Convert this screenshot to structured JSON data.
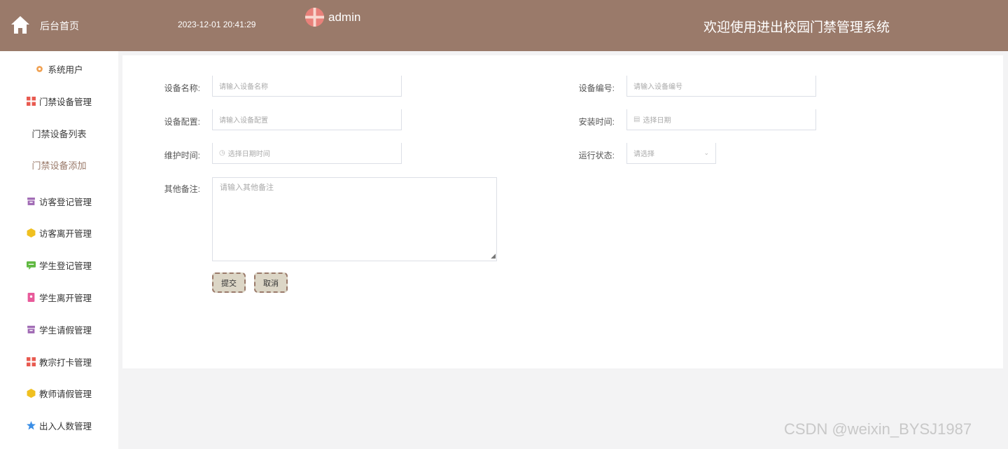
{
  "header": {
    "home_label": "后台首页",
    "datetime": "2023-12-01 20:41:29",
    "username": "admin",
    "system_title": "欢迎使用进出校园门禁管理系统"
  },
  "sidebar": {
    "items": [
      {
        "label": "系统用户",
        "icon": "gear-icon",
        "color": "#f0a050"
      },
      {
        "label": "门禁设备管理",
        "icon": "grid-icon",
        "color": "#e85a50"
      },
      {
        "label": "门禁设备列表"
      },
      {
        "label": "门禁设备添加"
      },
      {
        "label": "访客登记管理",
        "icon": "box-icon",
        "color": "#a06ab4"
      },
      {
        "label": "访客离开管理",
        "icon": "cube-icon",
        "color": "#f0c020"
      },
      {
        "label": "学生登记管理",
        "icon": "message-icon",
        "color": "#5fb840"
      },
      {
        "label": "学生离开管理",
        "icon": "document-icon",
        "color": "#e85a9a"
      },
      {
        "label": "学生请假管理",
        "icon": "box-icon",
        "color": "#a06ab4"
      },
      {
        "label": "教宗打卡管理",
        "icon": "grid-icon",
        "color": "#e85a50"
      },
      {
        "label": "教师请假管理",
        "icon": "cube-icon",
        "color": "#f0c020"
      },
      {
        "label": "出入人数管理",
        "icon": "star-icon",
        "color": "#3a8ee6"
      }
    ]
  },
  "form": {
    "device_name": {
      "label": "设备名称:",
      "placeholder": "请输入设备名称"
    },
    "device_no": {
      "label": "设备编号:",
      "placeholder": "请输入设备编号"
    },
    "device_config": {
      "label": "设备配置:",
      "placeholder": "请输入设备配置"
    },
    "install_time": {
      "label": "安装时间:",
      "placeholder": "选择日期"
    },
    "maintain_time": {
      "label": "维护时间:",
      "placeholder": "选择日期时间"
    },
    "run_status": {
      "label": "运行状态:",
      "placeholder": "请选择"
    },
    "remarks": {
      "label": "其他备注:",
      "placeholder": "请输入其他备注"
    },
    "submit_label": "提交",
    "cancel_label": "取消"
  },
  "watermark": "CSDN @weixin_BYSJ1987",
  "colors": {
    "header_bg": "#9a7a6a",
    "button_bg": "#dcd6c6",
    "button_border": "#9a7a6a"
  }
}
